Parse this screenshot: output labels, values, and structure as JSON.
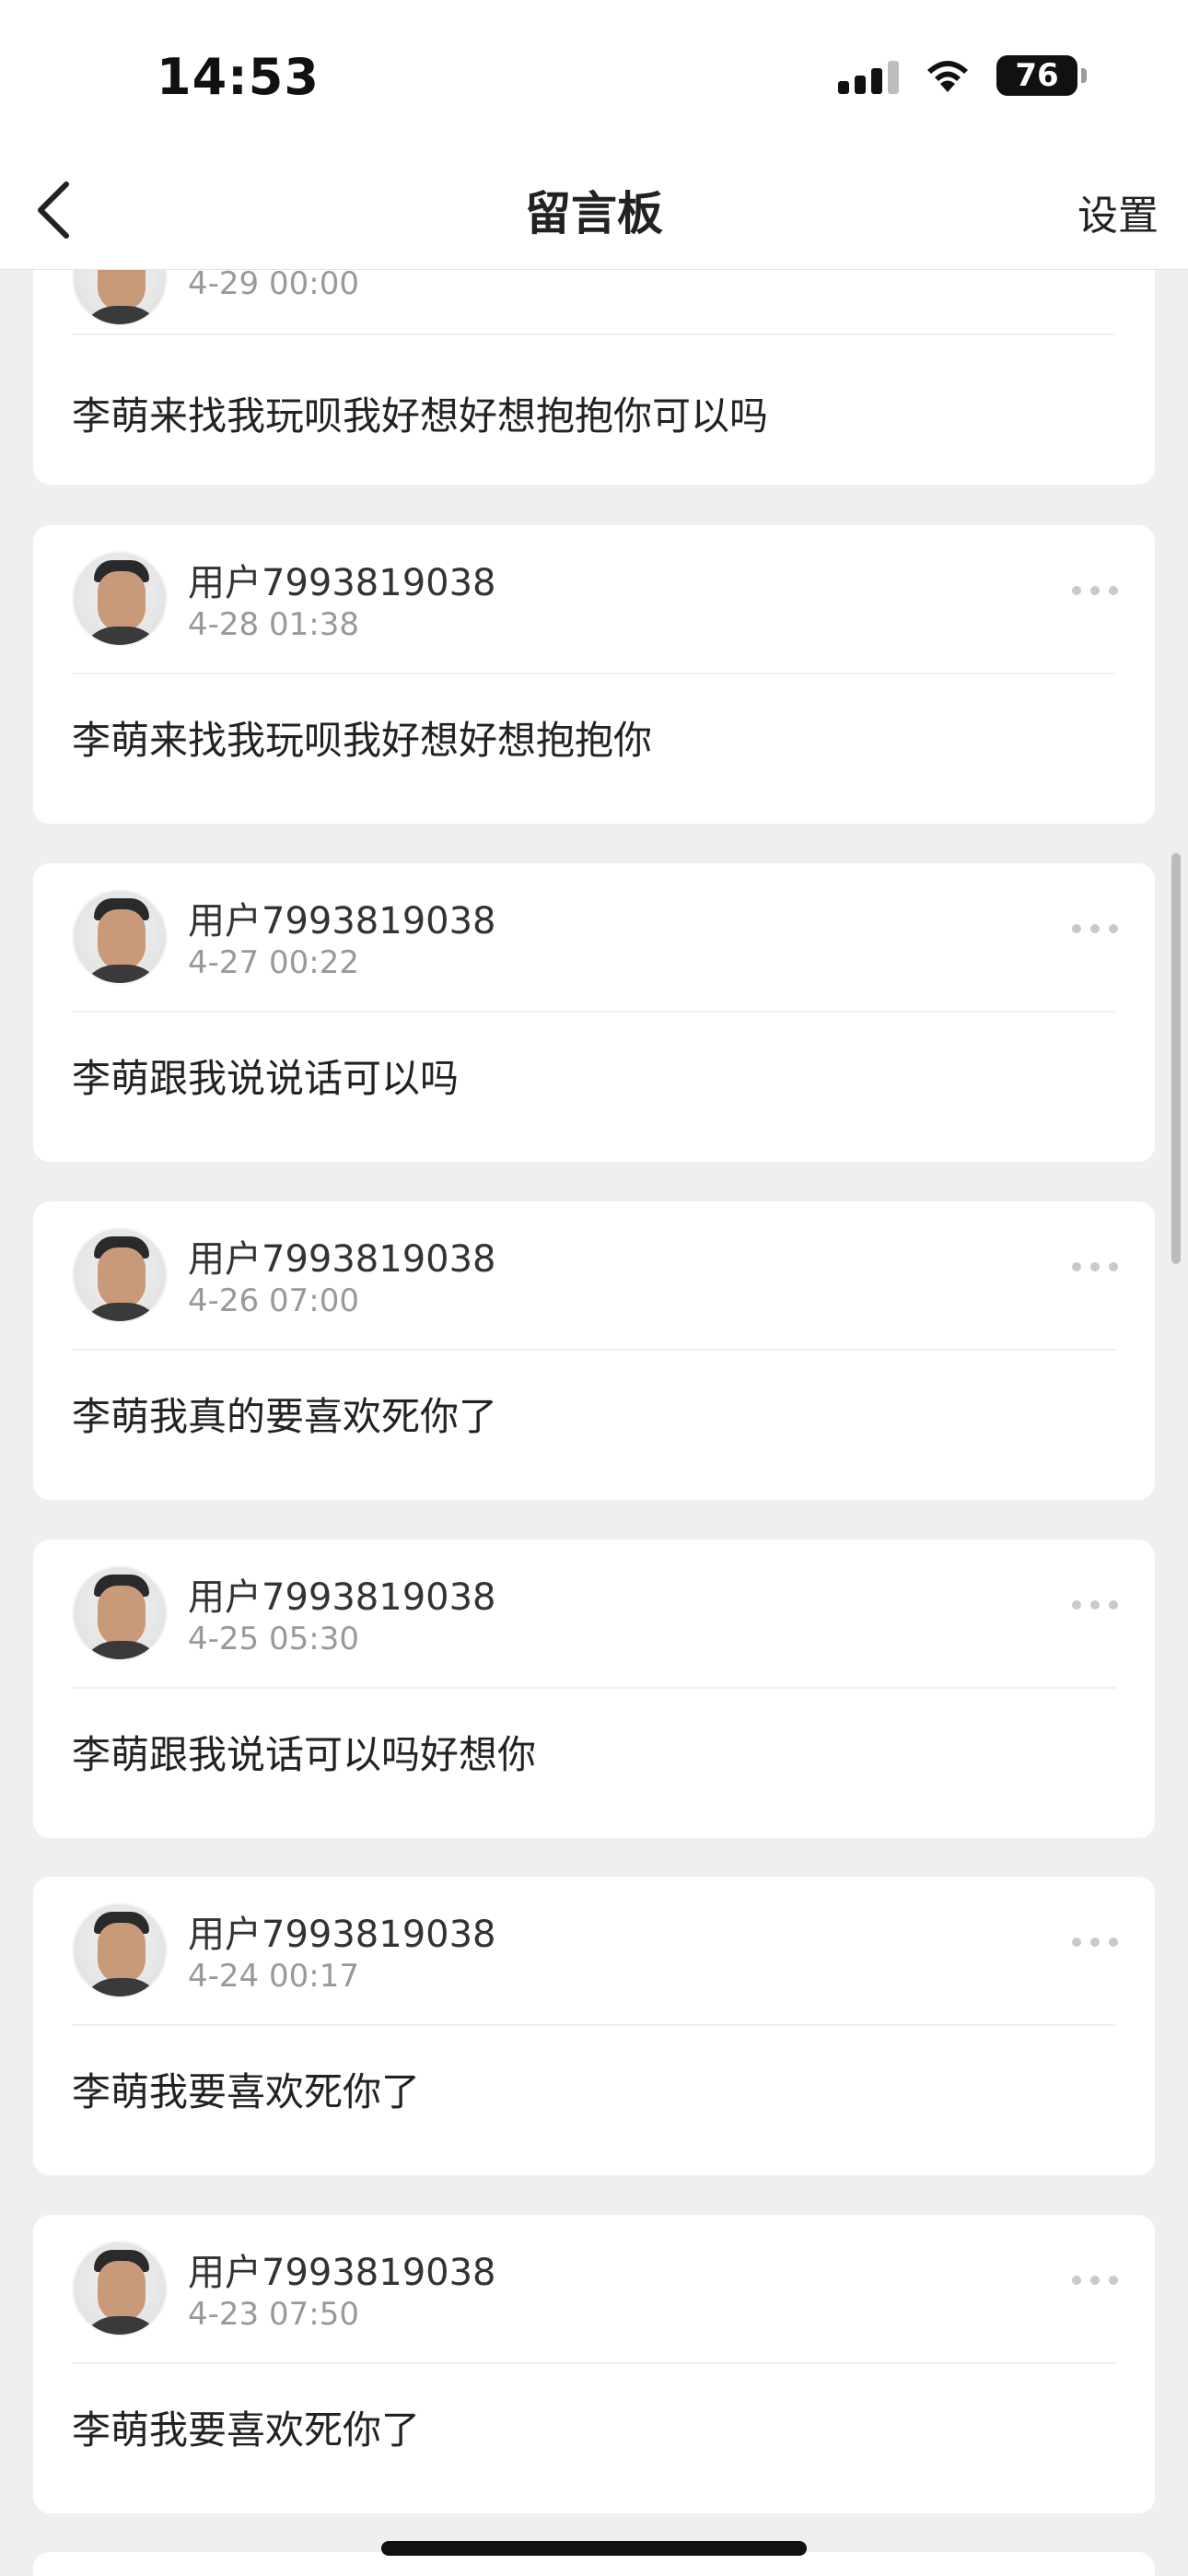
{
  "status": {
    "time": "14:53",
    "battery": "76"
  },
  "nav": {
    "title": "留言板",
    "settings": "设置",
    "back_icon": "chevron-left-icon"
  },
  "posts": [
    {
      "time": "4-29 00:00",
      "text": "李萌来找我玩呗我好想好想抱抱你可以吗"
    },
    {
      "user": "用户7993819038",
      "time": "4-28 01:38",
      "text": "李萌来找我玩呗我好想好想抱抱你"
    },
    {
      "user": "用户7993819038",
      "time": "4-27 00:22",
      "text": "李萌跟我说说话可以吗"
    },
    {
      "user": "用户7993819038",
      "time": "4-26 07:00",
      "text": "李萌我真的要喜欢死你了"
    },
    {
      "user": "用户7993819038",
      "time": "4-25 05:30",
      "text": "李萌跟我说话可以吗好想你"
    },
    {
      "user": "用户7993819038",
      "time": "4-24 00:17",
      "text": "李萌我要喜欢死你了"
    },
    {
      "user": "用户7993819038",
      "time": "4-23 07:50",
      "text": "李萌我要喜欢死你了"
    }
  ]
}
